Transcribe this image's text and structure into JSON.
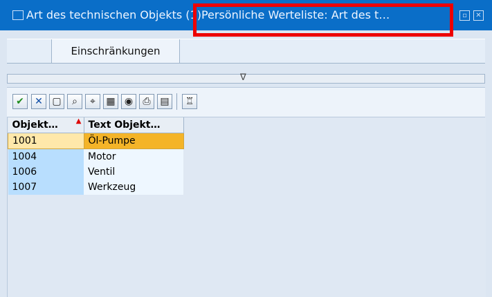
{
  "window": {
    "title": "Art des technischen Objekts (1)Persönliche Werteliste: Art des t…",
    "controls": [
      "minimize",
      "close"
    ]
  },
  "tabs": [
    {
      "label": "Einschränkungen"
    }
  ],
  "splitter": {
    "arrow": "∇"
  },
  "toolbar": {
    "buttons": [
      {
        "name": "confirm",
        "icon": "checkmark-icon",
        "glyph": "✔"
      },
      {
        "name": "cancel",
        "icon": "x-icon",
        "glyph": "✕"
      },
      {
        "name": "new-document",
        "icon": "document-icon",
        "glyph": "▢"
      },
      {
        "name": "find",
        "icon": "binoculars-icon",
        "glyph": "⌕"
      },
      {
        "name": "find-next",
        "icon": "binoculars-plus-icon",
        "glyph": "⌖"
      },
      {
        "name": "filter",
        "icon": "filter-icon",
        "glyph": "▦"
      },
      {
        "name": "select-layout",
        "icon": "layout-icon",
        "glyph": "◉"
      },
      {
        "name": "print",
        "icon": "printer-icon",
        "glyph": "⎙"
      },
      {
        "name": "details",
        "icon": "details-icon",
        "glyph": "▤"
      },
      {
        "name": "reset",
        "icon": "broom-icon",
        "glyph": "♖"
      }
    ]
  },
  "table": {
    "columns": [
      {
        "label": "Objekt…"
      },
      {
        "label": "Text Objekt…"
      }
    ],
    "rows": [
      {
        "key": "1001",
        "text": "Öl-Pumpe",
        "selected": true
      },
      {
        "key": "1004",
        "text": "Motor",
        "selected": false
      },
      {
        "key": "1006",
        "text": "Ventil",
        "selected": false
      },
      {
        "key": "1007",
        "text": "Werkzeug",
        "selected": false
      }
    ]
  }
}
